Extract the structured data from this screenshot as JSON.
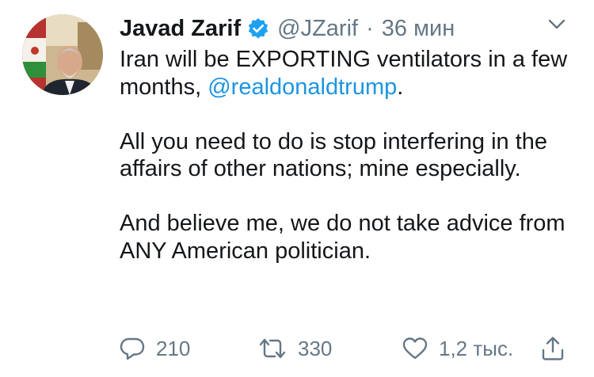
{
  "tweet": {
    "author_name": "Javad Zarif",
    "author_handle": "@JZarif",
    "separator": "·",
    "time": "36 мин",
    "text_line1_before": "Iran will be EXPORTING ventilators in a few months, ",
    "mention": "@realdonaldtrump",
    "text_line1_after": ".",
    "paragraph2": "All you need to do is stop interfering in the affairs of other nations; mine especially.",
    "paragraph3": "And believe me, we do not take advice from ANY American politician."
  },
  "actions": {
    "reply_count": "210",
    "retweet_count": "330",
    "like_count": "1,2 тыс."
  },
  "colors": {
    "text": "#14171a",
    "secondary": "#657786",
    "link": "#1b95e0",
    "verified": "#1da1f2"
  },
  "icons": [
    "verified-badge-icon",
    "chevron-down-icon",
    "reply-icon",
    "retweet-icon",
    "like-icon",
    "share-icon"
  ]
}
